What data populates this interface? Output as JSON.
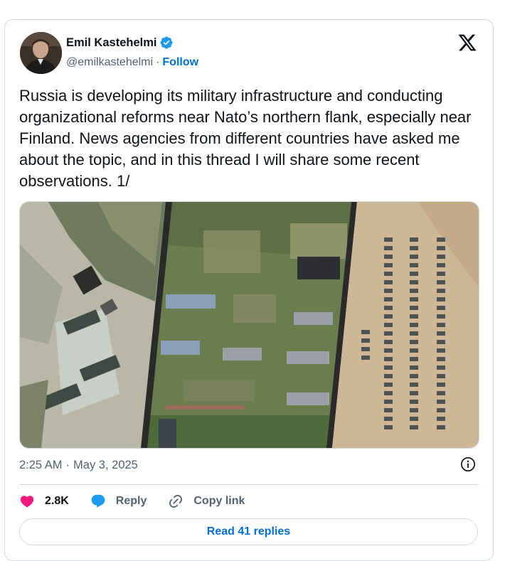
{
  "author": {
    "name": "Emil Kastehelmi",
    "handle": "@emilkastehelmi",
    "separator": "·",
    "follow_label": "Follow",
    "verified_color": "#1d9bf0"
  },
  "tweet": {
    "text": "Russia is developing its military infrastructure and conducting organizational reforms near Nato’s northern flank, especially near Finland. News agencies from different countries have asked me about the topic, and in this thread I will share some recent observations. 1/"
  },
  "meta": {
    "time": "2:25 AM",
    "separator": "·",
    "date": "May 3, 2025"
  },
  "actions": {
    "likes": "2.8K",
    "reply_label": "Reply",
    "copy_link_label": "Copy link"
  },
  "read_replies_label": "Read 41 replies",
  "colors": {
    "like": "#f91880",
    "reply": "#1d9bf0",
    "link": "#006fd6",
    "border": "#cfd9de",
    "secondary_text": "#536471"
  },
  "icons": [
    "x-logo-icon",
    "verified-badge-icon",
    "info-icon",
    "heart-icon",
    "reply-bubble-icon",
    "link-icon"
  ]
}
